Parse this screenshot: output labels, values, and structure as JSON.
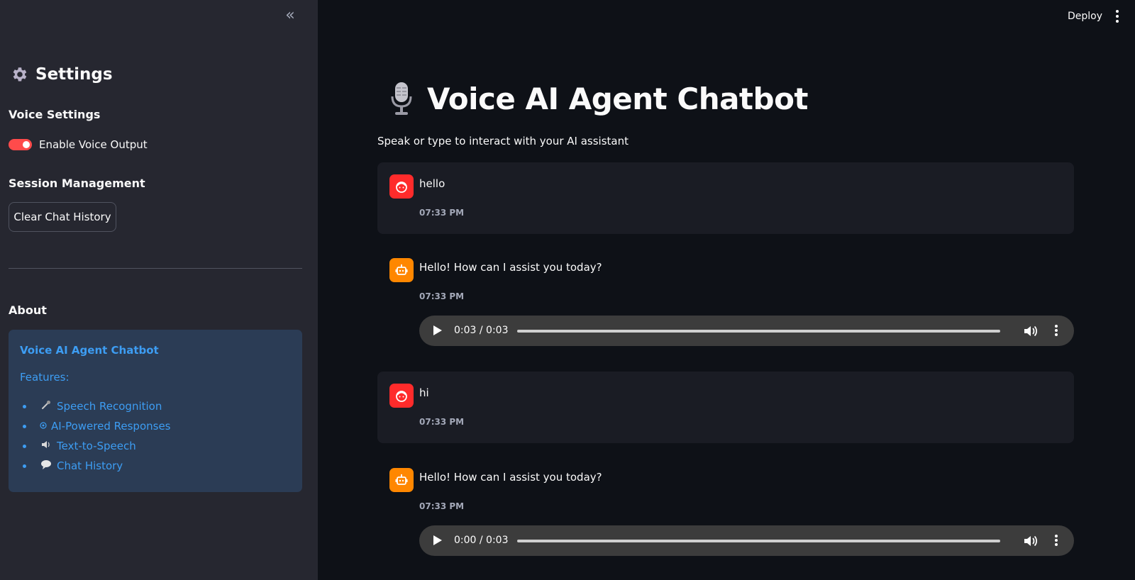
{
  "sidebar": {
    "collapse_glyph": "«",
    "title": "Settings",
    "voice_settings_heading": "Voice Settings",
    "voice_toggle_label": "Enable Voice Output",
    "voice_toggle_on": true,
    "session_heading": "Session Management",
    "clear_button_label": "Clear Chat History",
    "about_heading": "About",
    "about": {
      "title": "Voice AI Agent Chatbot",
      "features_label": "Features:",
      "features": [
        {
          "icon": "microphone-icon",
          "label": "Speech Recognition"
        },
        {
          "icon": "ai-icon",
          "label": "AI-Powered Responses"
        },
        {
          "icon": "speaker-icon",
          "label": "Text-to-Speech"
        },
        {
          "icon": "speech-bubble-icon",
          "label": "Chat History"
        }
      ]
    }
  },
  "header": {
    "deploy_label": "Deploy"
  },
  "main": {
    "title": "Voice AI Agent Chatbot",
    "subtitle": "Speak or type to interact with your AI assistant",
    "messages": [
      {
        "role": "user",
        "text": "hello",
        "time": "07:33 PM"
      },
      {
        "role": "assistant",
        "text": "Hello! How can I assist you today?",
        "time": "07:33 PM",
        "audio_time": "0:03 / 0:03",
        "audio_progress": 1.0
      },
      {
        "role": "user",
        "text": "hi",
        "time": "07:33 PM"
      },
      {
        "role": "assistant",
        "text": "Hello! How can I assist you today?",
        "time": "07:33 PM",
        "audio_time": "0:00 / 0:03",
        "audio_progress": 0.0
      }
    ]
  },
  "colors": {
    "background": "#0e1117",
    "sidebar": "#262730",
    "accent": "#ff4b4b",
    "user_avatar": "#ff2b2b",
    "bot_avatar": "#ff8700",
    "about_box": "#2b3c55",
    "about_text": "#3d9df3"
  }
}
